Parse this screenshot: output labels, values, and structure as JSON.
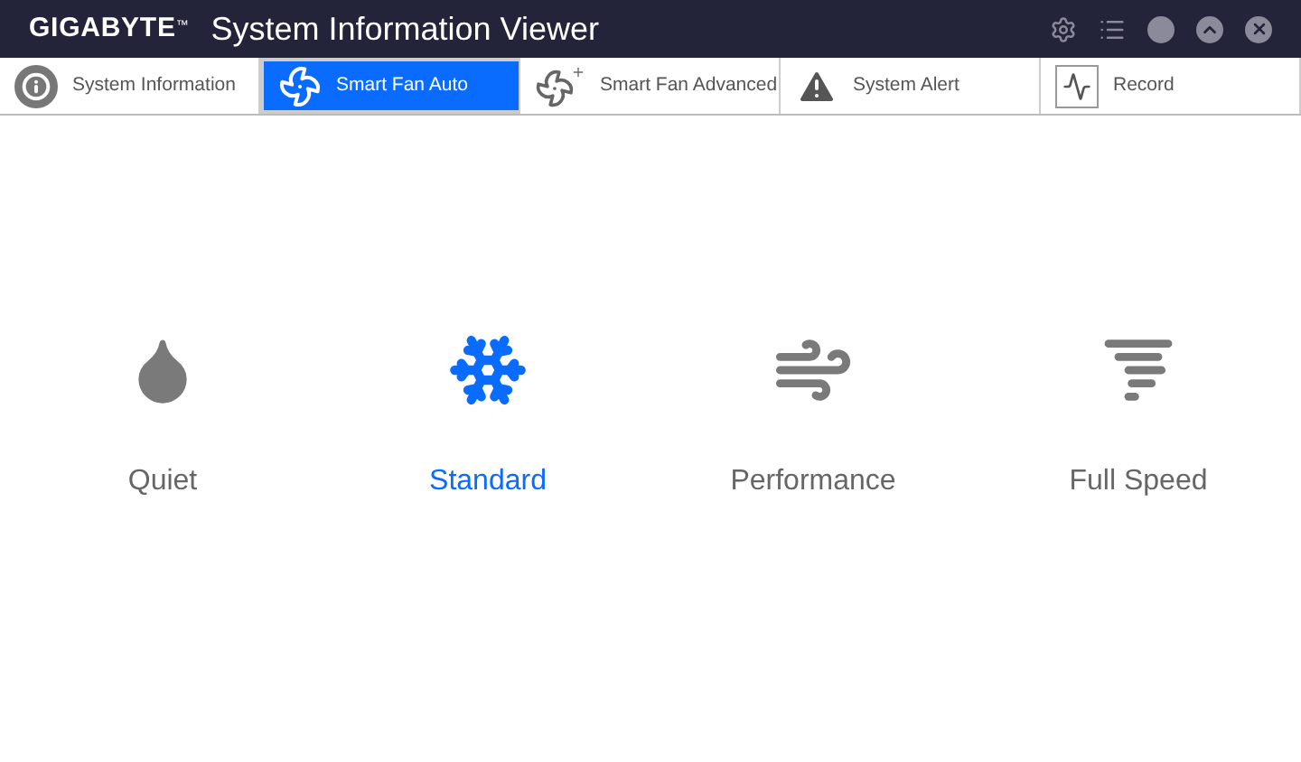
{
  "window": {
    "brand": "GIGABYTE",
    "brand_mark": "™",
    "title": "System Information Viewer"
  },
  "tabs": [
    {
      "label": "System Information",
      "kind": "info",
      "selected": false
    },
    {
      "label": "Smart Fan Auto",
      "kind": "fan",
      "selected": true
    },
    {
      "label": "Smart Fan Advanced",
      "kind": "fan-plus",
      "selected": false
    },
    {
      "label": "System Alert",
      "kind": "alert",
      "selected": false
    },
    {
      "label": "Record",
      "kind": "record",
      "selected": false
    }
  ],
  "modes": [
    {
      "label": "Quiet",
      "kind": "drop",
      "selected": false
    },
    {
      "label": "Standard",
      "kind": "snowflake",
      "selected": true
    },
    {
      "label": "Performance",
      "kind": "wind",
      "selected": false
    },
    {
      "label": "Full Speed",
      "kind": "tornado",
      "selected": false
    }
  ]
}
